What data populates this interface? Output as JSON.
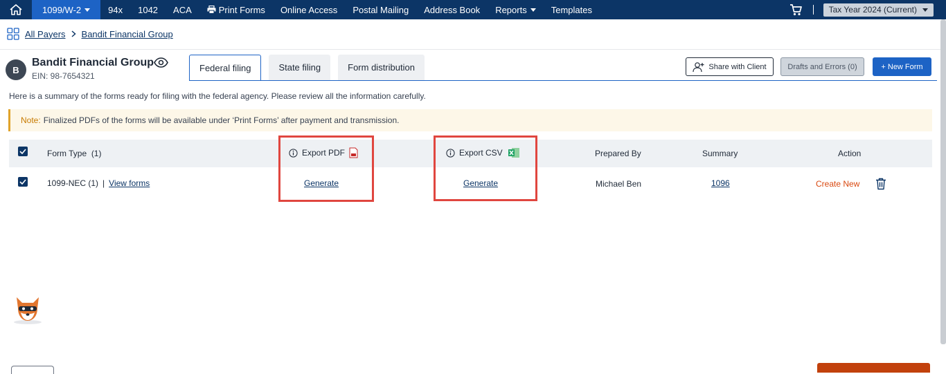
{
  "topnav": {
    "items": [
      {
        "label": "1099/W-2",
        "active": true,
        "dropdown": true
      },
      {
        "label": "94x"
      },
      {
        "label": "1042"
      },
      {
        "label": "ACA"
      },
      {
        "label": "Print Forms",
        "icon": "printer-icon"
      },
      {
        "label": "Online Access"
      },
      {
        "label": "Postal Mailing"
      },
      {
        "label": "Address Book"
      },
      {
        "label": "Reports",
        "dropdown": true
      },
      {
        "label": "Templates"
      }
    ],
    "tax_year": "Tax Year 2024 (Current)"
  },
  "breadcrumb": {
    "root": "All Payers",
    "current": "Bandit Financial Group"
  },
  "payer": {
    "initial": "B",
    "name": "Bandit Financial Group",
    "ein": "EIN: 98-7654321"
  },
  "tabs": [
    "Federal filing",
    "State filing",
    "Form distribution"
  ],
  "buttons": {
    "share": "Share with Client",
    "drafts": "Drafts and Errors (0)",
    "new_form": "+ New Form"
  },
  "summary": "Here is a summary of the forms ready for filing with the federal agency. Please review all the information carefully.",
  "note": {
    "label": "Note:",
    "text": "Finalized PDFs of the forms will be available under ‘Print Forms’ after payment and transmission."
  },
  "table": {
    "headers": {
      "form_type": "Form Type",
      "form_count": "(1)",
      "export_pdf": "Export PDF",
      "export_csv": "Export CSV",
      "prepared_by": "Prepared By",
      "summary": "Summary",
      "action": "Action"
    },
    "rows": [
      {
        "form": "1099-NEC",
        "count": "(1)",
        "divider": "|",
        "view": "View forms",
        "pdf": "Generate",
        "csv": "Generate",
        "prepared_by": "Michael Ben",
        "summary": "1096",
        "action": "Create New"
      }
    ]
  },
  "colors": {
    "nav": "#0c3566",
    "accent": "#1d63c5",
    "highlight": "#e0463f",
    "action": "#d9480f"
  }
}
